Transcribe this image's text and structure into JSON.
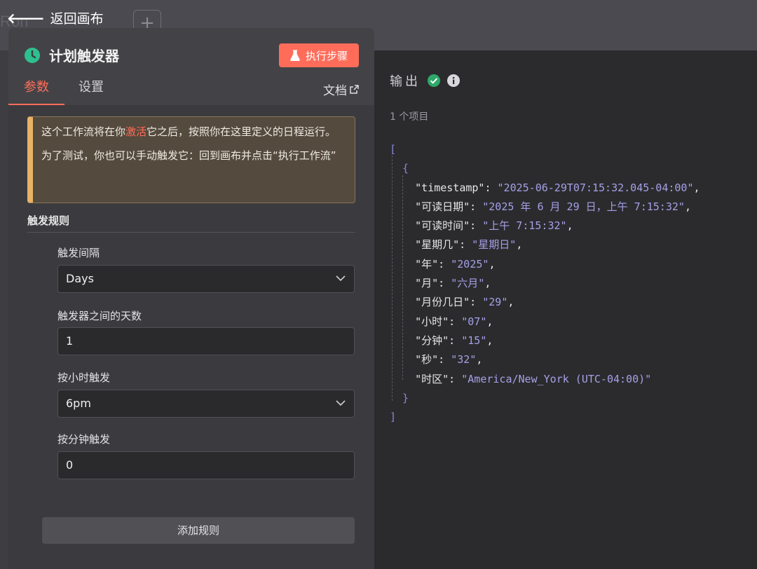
{
  "topbar": {
    "back_label": "返回画布",
    "ghost_node_text": "Ron",
    "ghost_plus": "+"
  },
  "node": {
    "title": "计划触发器",
    "icon": "clock-icon",
    "execute_label": "执行步骤",
    "accent_color": "#ff6d5a"
  },
  "tabs": [
    {
      "label": "参数",
      "active": true
    },
    {
      "label": "设置",
      "active": false
    }
  ],
  "docs_label": "文档",
  "notice": {
    "p1_before": "这个工作流将在你",
    "p1_highlight": "激活",
    "p1_after": "它之后，按照你在这里定义的日程运行。",
    "p2": "为了测试，你也可以手动触发它：回到画布并点击“执行工作流”"
  },
  "rules": {
    "section_title": "触发规则",
    "interval_label": "触发间隔",
    "interval_value": "Days",
    "days_label": "触发器之间的天数",
    "days_value": "1",
    "hour_label": "按小时触发",
    "hour_value": "6pm",
    "minute_label": "按分钟触发",
    "minute_value": "0",
    "add_rule_label": "添加规则"
  },
  "output": {
    "title": "输出",
    "items_count": "1 个项目",
    "entries": [
      {
        "key": "timestamp",
        "value": "2025-06-29T07:15:32.045-04:00"
      },
      {
        "key": "可读日期",
        "value": "2025 年 6 月 29 日，上午 7:15:32"
      },
      {
        "key": "可读时间",
        "value": "上午 7:15:32"
      },
      {
        "key": "星期几",
        "value": "星期日"
      },
      {
        "key": "年",
        "value": "2025"
      },
      {
        "key": "月",
        "value": "六月"
      },
      {
        "key": "月份几日",
        "value": "29"
      },
      {
        "key": "小时",
        "value": "07"
      },
      {
        "key": "分钟",
        "value": "15"
      },
      {
        "key": "秒",
        "value": "32"
      },
      {
        "key": "时区",
        "value": "America/New_York (UTC-04:00)"
      }
    ]
  }
}
